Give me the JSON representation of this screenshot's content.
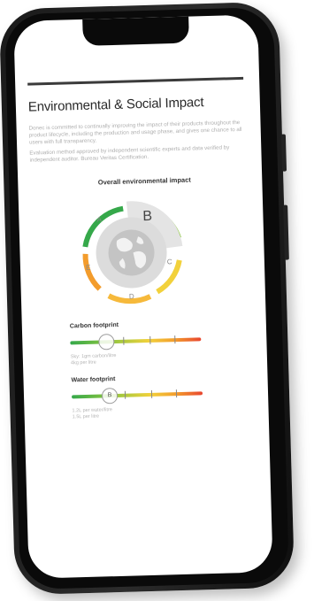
{
  "page": {
    "title": "Environmental & Social Impact",
    "paragraph_1": "Donec is committed to continually improving the impact of their products throughout the product lifecycle, including the production and usage phase, and gives one chance to all users with full transparency.",
    "paragraph_2": "Evaluation method approved by independent scientific experts and data verified by independent auditor. Bureau Veritas Certification."
  },
  "impact": {
    "heading": "Overall environmental impact",
    "grades": [
      "A",
      "B",
      "C",
      "D",
      "E"
    ],
    "selected": "B"
  },
  "carbon": {
    "heading": "Carbon footprint",
    "marker_label": "",
    "line_1": "Sky: 1gm carbon/litre",
    "line_2": "4kg per litre"
  },
  "water": {
    "heading": "Water footprint",
    "marker_label": "B",
    "line_1": "1.2L per water/litre",
    "line_2": "1.5L per litre"
  },
  "colors": {
    "green": "#35a84a",
    "light_green": "#8cc63f",
    "yellow": "#f2d13b",
    "orange": "#f39c2c",
    "red": "#e8452f",
    "phone_body": "#1f1f1f"
  }
}
